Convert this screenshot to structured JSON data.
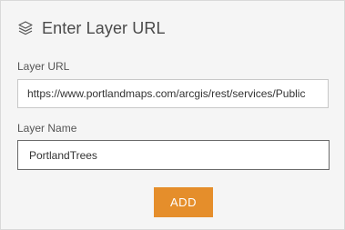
{
  "dialog": {
    "title": "Enter Layer URL",
    "title_icon": "layers-icon"
  },
  "form": {
    "url_label": "Layer URL",
    "url_value": "https://www.portlandmaps.com/arcgis/rest/services/Public",
    "name_label": "Layer Name",
    "name_value": "PortlandTrees",
    "add_label": "ADD"
  },
  "colors": {
    "accent": "#e58e2b",
    "panel_background": "#f5f5f5",
    "focused_border": "#6a6a6a"
  }
}
